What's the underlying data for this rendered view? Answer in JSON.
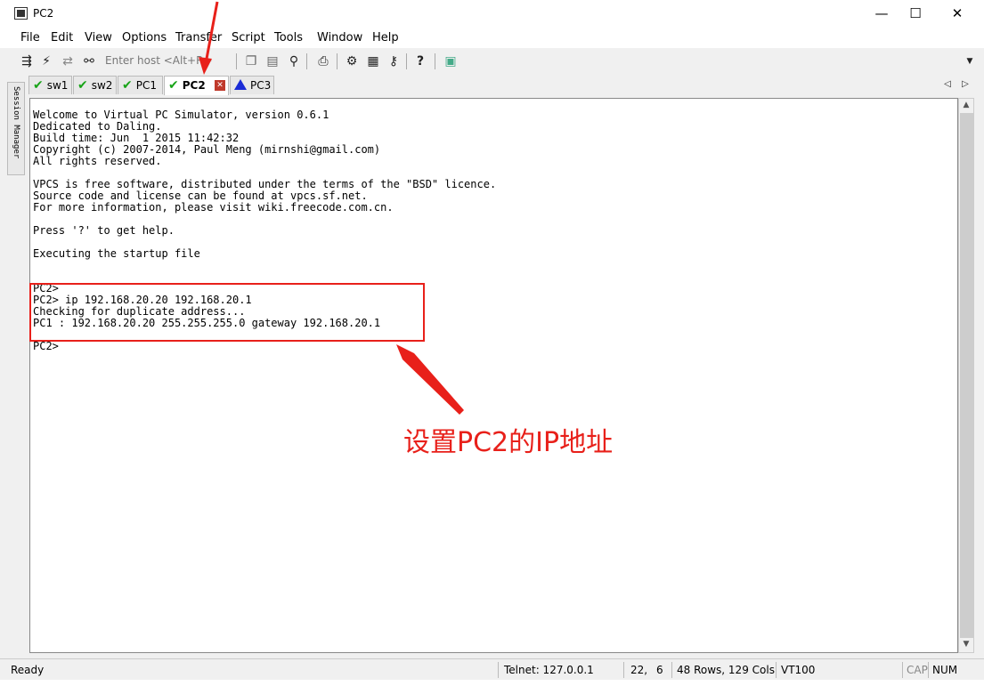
{
  "window": {
    "title": "PC2",
    "minimize": "—",
    "maximize": "☐",
    "close": "✕"
  },
  "menu": [
    "File",
    "Edit",
    "View",
    "Options",
    "Transfer",
    "Script",
    "Tools",
    "Window",
    "Help"
  ],
  "toolbar": {
    "host_placeholder": "Enter host <Alt+R>",
    "help_icon": "?"
  },
  "tabs": [
    {
      "label": "sw1",
      "status": "ok"
    },
    {
      "label": "sw2",
      "status": "ok"
    },
    {
      "label": "PC1",
      "status": "ok"
    },
    {
      "label": "PC2",
      "status": "ok",
      "active": true
    },
    {
      "label": "PC3",
      "status": "warning"
    }
  ],
  "sidebar": {
    "label": "Session Manager"
  },
  "terminal": {
    "text": "Welcome to Virtual PC Simulator, version 0.6.1\nDedicated to Daling.\nBuild time: Jun  1 2015 11:42:32\nCopyright (c) 2007-2014, Paul Meng (mirnshi@gmail.com)\nAll rights reserved.\n\nVPCS is free software, distributed under the terms of the \"BSD\" licence.\nSource code and license can be found at vpcs.sf.net.\nFor more information, please visit wiki.freecode.com.cn.\n\nPress '?' to get help.\n\nExecuting the startup file\n\n\nPC2>\nPC2> ip 192.168.20.20 192.168.20.1\nChecking for duplicate address...\nPC1 : 192.168.20.20 255.255.255.0 gateway 192.168.20.1\n\nPC2>"
  },
  "annotation": {
    "text": "设置PC2的IP地址",
    "color": "#e8201a"
  },
  "status": {
    "ready": "Ready",
    "telnet": "Telnet: 127.0.0.1",
    "pos_row": "22,",
    "pos_col": "6",
    "size": "48 Rows, 129 Cols",
    "term": "VT100",
    "cap": "CAP",
    "num": "NUM"
  }
}
